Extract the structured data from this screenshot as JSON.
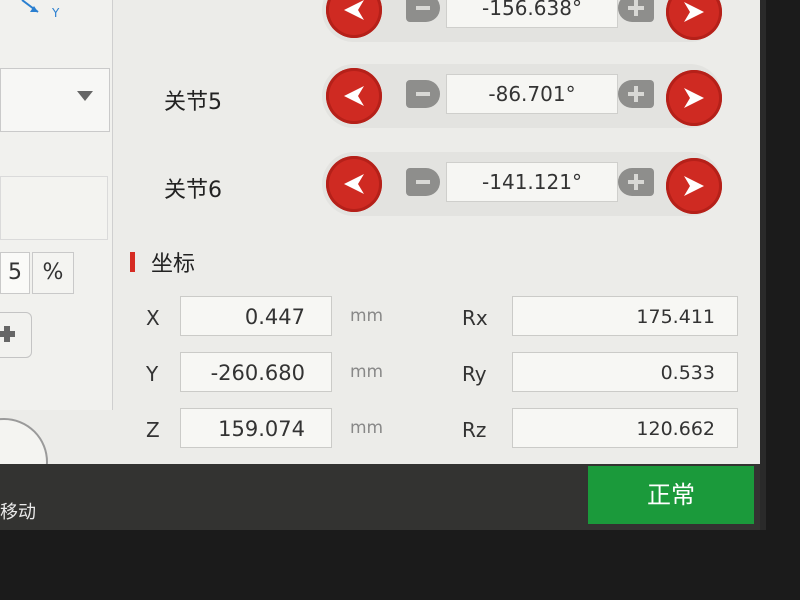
{
  "left_panel": {
    "axis_label": "Y",
    "speed_value": "5",
    "speed_unit": "%",
    "move_label": "移动"
  },
  "joints": [
    {
      "label": "",
      "value": "-156.638°"
    },
    {
      "label": "关节5",
      "value": "-86.701°"
    },
    {
      "label": "关节6",
      "value": "-141.121°"
    }
  ],
  "coordinates": {
    "title": "坐标",
    "rows": [
      {
        "axis": "X",
        "value": "0.447",
        "unit": "mm",
        "rot_axis": "Rx",
        "rot_value": "175.411"
      },
      {
        "axis": "Y",
        "value": "-260.680",
        "unit": "mm",
        "rot_axis": "Ry",
        "rot_value": "0.533"
      },
      {
        "axis": "Z",
        "value": "159.074",
        "unit": "mm",
        "rot_axis": "Rz",
        "rot_value": "120.662"
      }
    ]
  },
  "status": {
    "label": "正常",
    "color": "#1b9a3b"
  },
  "colors": {
    "accent_red": "#cf2a22"
  }
}
